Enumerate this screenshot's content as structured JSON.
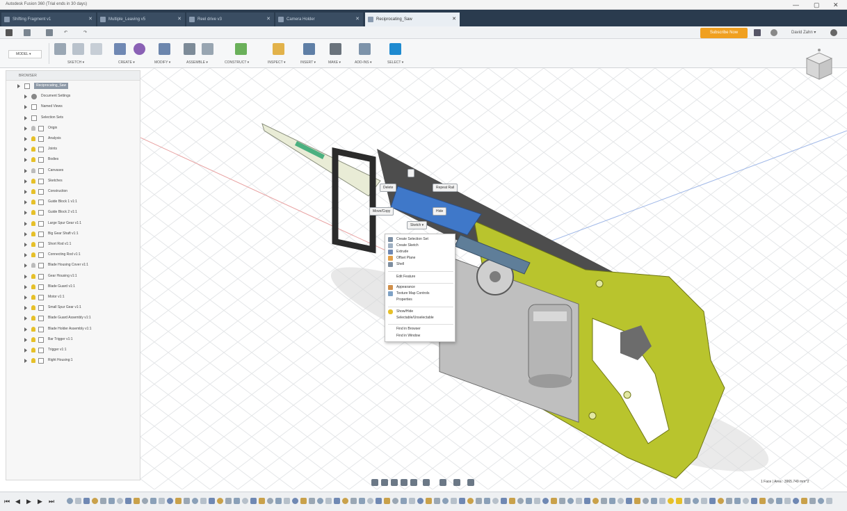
{
  "window": {
    "title": "Autodesk Fusion 360 (Trial ends in 30 days)",
    "controls": [
      "—",
      "▢",
      "✕"
    ]
  },
  "tabs": [
    {
      "label": "Shifting Fragment v1"
    },
    {
      "label": "Multiple_Leaving v5"
    },
    {
      "label": "Reel drive v3"
    },
    {
      "label": "Camera Holder"
    },
    {
      "label": "Reciprocating_Saw"
    }
  ],
  "quick_access": {
    "undo_label": "",
    "redo_label": "",
    "subscribe_label": "Subscribe Now",
    "user_label": "David Zahn ▾"
  },
  "toolbar": {
    "workspace": "MODEL ▾",
    "groups": [
      {
        "label": "SKETCH ▾"
      },
      {
        "label": "CREATE ▾"
      },
      {
        "label": "MODIFY ▾"
      },
      {
        "label": "ASSEMBLE ▾"
      },
      {
        "label": "CONSTRUCT ▾"
      },
      {
        "label": "INSPECT ▾"
      },
      {
        "label": "INSERT ▾"
      },
      {
        "label": "MAKE ▾"
      },
      {
        "label": "ADD-INS ▾"
      },
      {
        "label": "SELECT ▾"
      }
    ]
  },
  "browser": {
    "title": "BROWSER",
    "items": [
      {
        "label": "Reciprocating_Saw"
      },
      {
        "label": "Document Settings"
      },
      {
        "label": "Named Views"
      },
      {
        "label": "Selection Sets"
      },
      {
        "label": "Origin"
      },
      {
        "label": "Analysis"
      },
      {
        "label": "Joints"
      },
      {
        "label": "Bodies"
      },
      {
        "label": "Canvases"
      },
      {
        "label": "Sketches"
      },
      {
        "label": "Construction"
      },
      {
        "label": "Guide Block 1 v1:1"
      },
      {
        "label": "Guide Block 2 v1:1"
      },
      {
        "label": "Large Spur Gear v1:1"
      },
      {
        "label": "Big Gear Shaft v1:1"
      },
      {
        "label": "Short Rod v1:1"
      },
      {
        "label": "Connecting Rod v1:1"
      },
      {
        "label": "Blade Housing Cover v1:1"
      },
      {
        "label": "Gear Housing v1:1"
      },
      {
        "label": "Blade Guard v1:1"
      },
      {
        "label": "Motor v1:1"
      },
      {
        "label": "Small Spur Gear v1:1"
      },
      {
        "label": "Blade Guard Assembly v1:1"
      },
      {
        "label": "Blade Holder Assembly v1:1"
      },
      {
        "label": "Bar Trigger v1:1"
      },
      {
        "label": "Trigger v1:1"
      },
      {
        "label": "Right Housing:1"
      }
    ]
  },
  "marking_menu": {
    "repeat": "Repeat Rail",
    "delete": "Delete",
    "hide": "Hide",
    "move_copy": "Move/Copy",
    "sketch": "Sketch ▾"
  },
  "context_menu": [
    {
      "label": "Create Selection Set"
    },
    {
      "label": "Create Sketch"
    },
    {
      "label": "Extrude"
    },
    {
      "label": "Offset Plane"
    },
    {
      "label": "Shell"
    },
    {
      "label": "Edit Feature"
    },
    {
      "label": "Appearance"
    },
    {
      "label": "Texture Map Controls"
    },
    {
      "label": "Properties"
    },
    {
      "label": "Show/Hide"
    },
    {
      "label": "Selectable/Unselectable"
    },
    {
      "label": "Find in Browser"
    },
    {
      "label": "Find in Window"
    }
  ],
  "status": {
    "selection": "1 Face | Area : 3965.749 mm^2"
  },
  "colors": {
    "housing": "#b9c42d",
    "blade_holder": "#3f78c9",
    "tab_bar": "#2a3b4e",
    "subscribe": "#f0a020"
  },
  "icons": {
    "timeline_controls": [
      "⏮",
      "◀",
      "▶",
      "▶",
      "⏭"
    ]
  }
}
